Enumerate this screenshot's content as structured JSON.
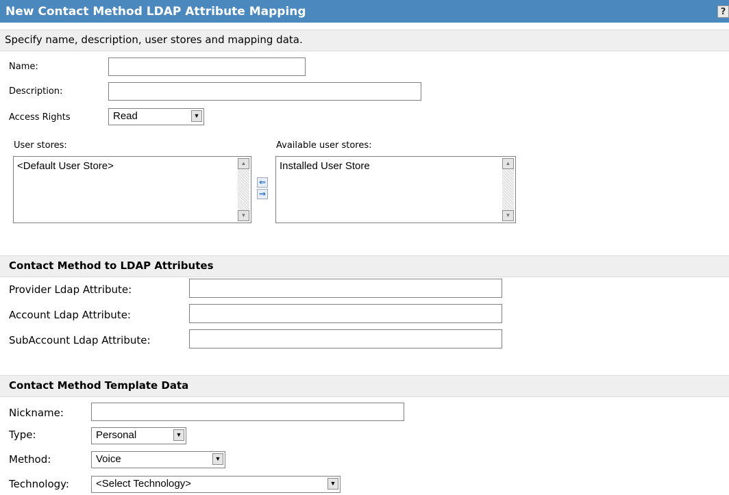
{
  "header": {
    "title": "New Contact Method LDAP Attribute Mapping",
    "help_label": "?"
  },
  "subheader": {
    "text": "Specify name, description, user stores and mapping data."
  },
  "form": {
    "name_label": "Name:",
    "name_value": "",
    "description_label": "Description:",
    "description_value": "",
    "access_rights_label": "Access Rights",
    "access_rights_value": "Read"
  },
  "user_stores": {
    "selected_label": "User stores:",
    "selected_items": [
      "<Default User Store>"
    ],
    "available_label": "Available user stores:",
    "available_items": [
      "Installed User Store"
    ],
    "move_left_icon": "left-arrow-icon",
    "move_right_icon": "right-arrow-icon"
  },
  "ldap_section": {
    "title": "Contact Method to LDAP Attributes",
    "provider_label": "Provider Ldap Attribute:",
    "provider_value": "",
    "account_label": "Account Ldap Attribute:",
    "account_value": "",
    "subaccount_label": "SubAccount Ldap Attribute:",
    "subaccount_value": ""
  },
  "template_section": {
    "title": "Contact Method Template Data",
    "nickname_label": "Nickname:",
    "nickname_value": "",
    "type_label": "Type:",
    "type_value": "Personal",
    "method_label": "Method:",
    "method_value": "Voice",
    "technology_label": "Technology:",
    "technology_value": "<Select Technology>"
  }
}
